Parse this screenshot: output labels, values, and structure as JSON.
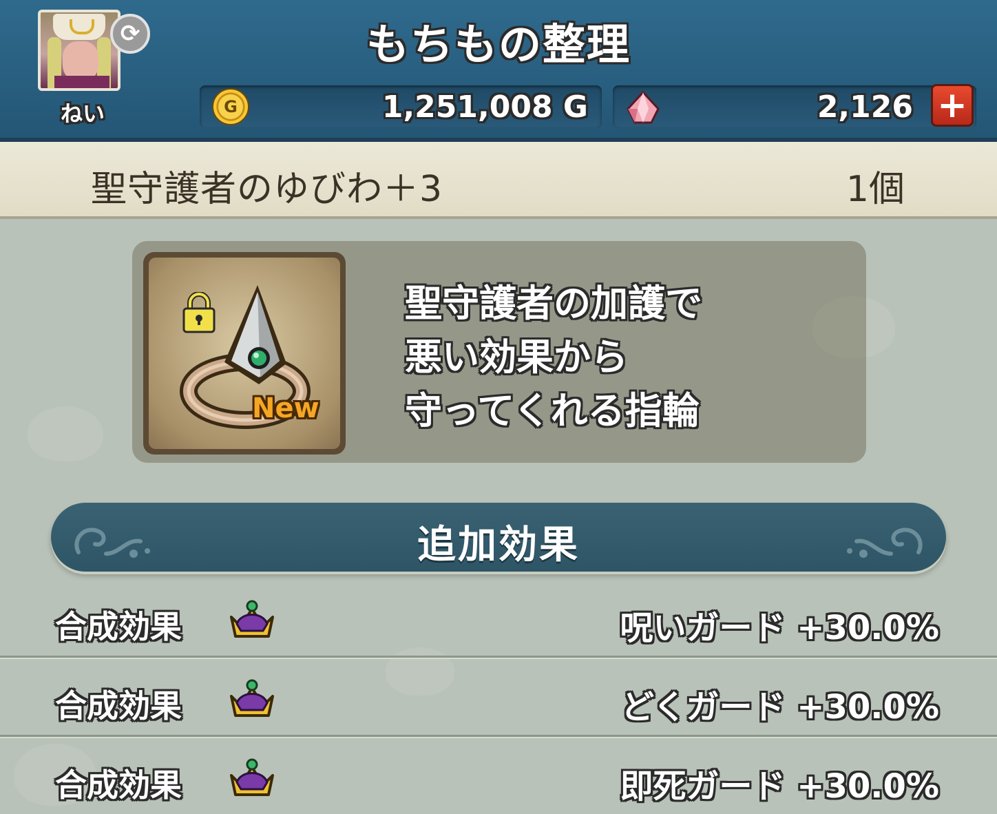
{
  "header": {
    "title": "もちもの整理",
    "username": "ねい",
    "refresh_icon": "refresh-icon",
    "gold": {
      "icon": "gold-coin-icon",
      "icon_letter": "G",
      "value": "1,251,008 G"
    },
    "gems": {
      "icon": "gem-icon",
      "value": "2,126",
      "add_label": "+"
    }
  },
  "item": {
    "name": "聖守護者のゆびわ＋3",
    "count": "1個",
    "icon": "ring-icon",
    "locked": true,
    "badge": "New",
    "description": [
      "聖守護者の加護で",
      "悪い効果から",
      "守ってくれる指輪"
    ]
  },
  "effects_section": {
    "title": "追加効果",
    "rows": [
      {
        "type": "合成効果",
        "icon": "crown-icon",
        "value": "呪いガード +30.0%"
      },
      {
        "type": "合成効果",
        "icon": "crown-icon",
        "value": "どくガード +30.0%"
      },
      {
        "type": "合成効果",
        "icon": "crown-icon",
        "value": "即死ガード +30.0%"
      }
    ]
  },
  "colors": {
    "header": "#2f6a8d",
    "name_bar": "#ece8d8",
    "section_header": "#3a6273",
    "plus_button": "#d63a24",
    "gold": "#f6c83a"
  }
}
